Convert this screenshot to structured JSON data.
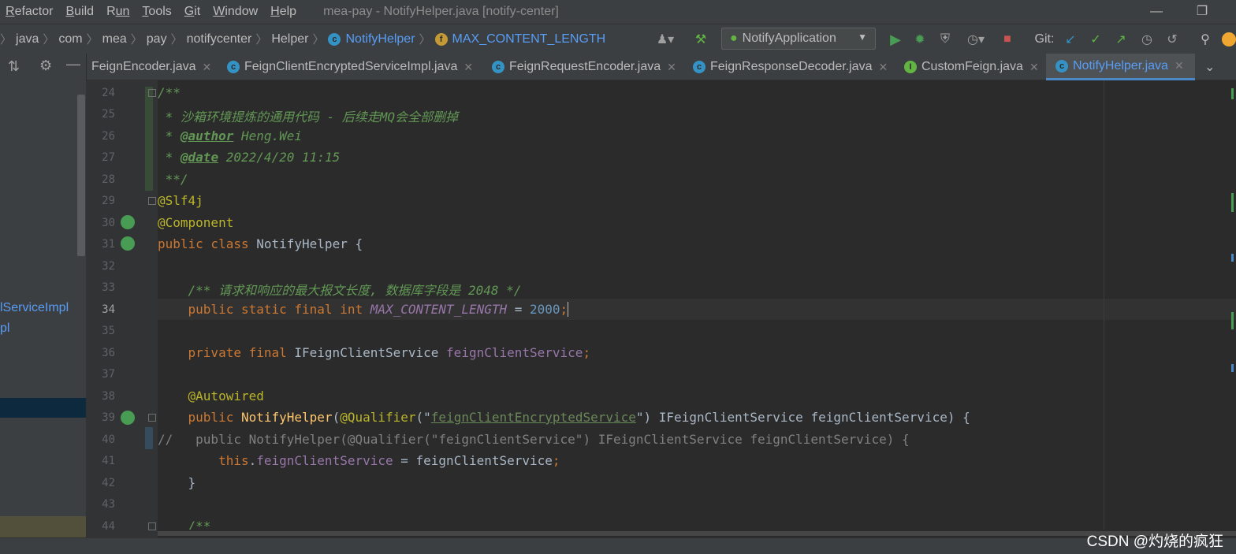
{
  "menubar": {
    "items": [
      {
        "label": "Refactor",
        "u": "R",
        "rest": "efactor"
      },
      {
        "label": "Build",
        "u": "B",
        "rest": "uild"
      },
      {
        "label": "Run",
        "u": "R",
        "rest": "un",
        "split": true
      },
      {
        "label": "Tools",
        "u": "T",
        "rest": "ools"
      },
      {
        "label": "Git",
        "u": "G",
        "rest": "it"
      },
      {
        "label": "Window",
        "u": "W",
        "rest": "indow"
      },
      {
        "label": "Help",
        "u": "H",
        "rest": "elp"
      }
    ],
    "window_title": "mea-pay - NotifyHelper.java [notify-center]"
  },
  "navbar": {
    "crumbs": [
      "java",
      "com",
      "mea",
      "pay",
      "notifycenter",
      "Helper",
      "NotifyHelper",
      "MAX_CONTENT_LENGTH"
    ],
    "run_config": "NotifyApplication",
    "git_label": "Git:"
  },
  "tabs": [
    {
      "label": "FeignEncoder.java",
      "icon": "c"
    },
    {
      "label": "FeignClientEncryptedServiceImpl.java",
      "icon": "c"
    },
    {
      "label": "FeignRequestEncoder.java",
      "icon": "c"
    },
    {
      "label": "FeignResponseDecoder.java",
      "icon": "c"
    },
    {
      "label": "CustomFeign.java",
      "icon": "i"
    },
    {
      "label": "NotifyHelper.java",
      "icon": "c",
      "active": true
    }
  ],
  "project": {
    "items": [
      "lServiceImpl",
      "pl"
    ]
  },
  "editor": {
    "line_numbers": [
      "24",
      "25",
      "26",
      "27",
      "28",
      "29",
      "30",
      "31",
      "32",
      "33",
      "34",
      "35",
      "36",
      "37",
      "38",
      "39",
      "40",
      "41",
      "42",
      "43",
      "44"
    ],
    "current_line": "34",
    "javadoc": {
      "open": "/**",
      "desc": " * 沙箱环境提炼的通用代码 - 后续走MQ会全部删掉",
      "author_tag": "@author",
      "author_val": " Heng.Wei",
      "date_tag": "@date",
      "date_val": " 2022/4/20 11:15",
      "close": " **/"
    },
    "ann_slf4j": "@Slf4j",
    "ann_component": "@Component",
    "class_decl": {
      "kw": "public class ",
      "name": "NotifyHelper {"
    },
    "field_doc": "/** 请求和响应的最大报文长度, 数据库字段是 2048 */",
    "const_decl": {
      "kw": "public static final int ",
      "name": "MAX_CONTENT_LENGTH",
      "eq": " = ",
      "val": "2000",
      "semi": ";"
    },
    "field_decl": {
      "kw": "private final ",
      "type": "IFeignClientService ",
      "name": "feignClientService",
      "semi": ";"
    },
    "ann_autowired": "@Autowired",
    "ctor": {
      "kw": "public ",
      "name": "NotifyHelper",
      "p1": "(",
      "ann": "@Qualifier",
      "p2": "(\"",
      "str": "feignClientEncryptedService",
      "p3": "\") IFeignClientService feignClientService) {"
    },
    "commented_line": "//   public NotifyHelper(@Qualifier(\"feignClientService\") IFeignClientService feignClientService) {",
    "assign": {
      "kw": "this",
      "dot": ".",
      "fld": "feignClientService",
      "rest": " = feignClientService",
      "semi": ";"
    },
    "close_brace": "}",
    "next_doc": "/**"
  },
  "watermark": "CSDN @灼烧的疯狂"
}
